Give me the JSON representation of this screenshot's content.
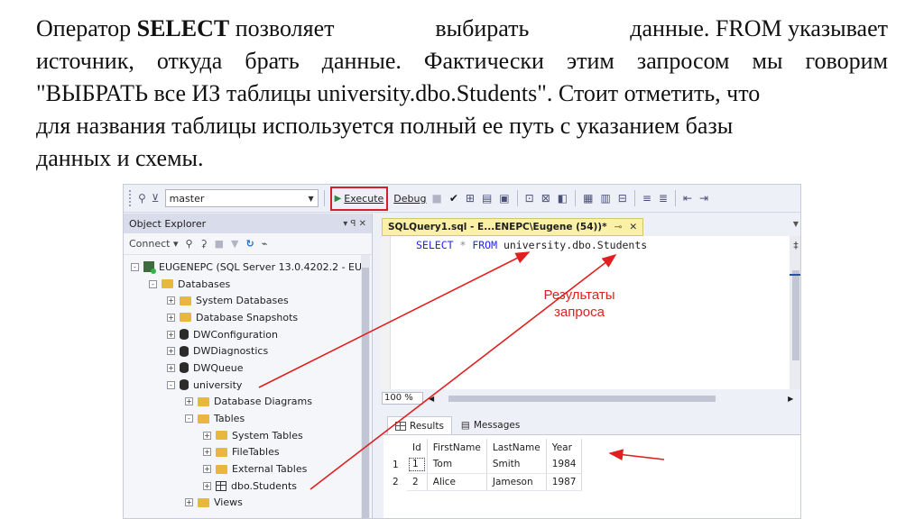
{
  "paragraph": {
    "line1_a": "Оператор",
    "line1_b": "SELECT",
    "line1_c": "позволяет",
    "line1_d": "выбирать",
    "line1_e": "данные. FROM указывает",
    "line2": "источник, откуда брать данные. Фактически этим запросом мы говорим",
    "line3": "\"ВЫБРАТЬ все ИЗ таблицы university.dbo.Students\". Стоит отметить, что",
    "line4": "для названия таблицы используется полный ее путь с указанием базы",
    "line5": "данных и схемы."
  },
  "toolbar": {
    "database": "master",
    "execute_label": "Execute",
    "debug_label": "Debug"
  },
  "object_explorer": {
    "title": "Object Explorer",
    "pin": "▾ ꟼ ✕",
    "connect_label": "Connect ▾",
    "tree": [
      {
        "label": "EUGENEPC (SQL Server 13.0.4202.2 - EU",
        "icon": "server-icon",
        "expander": "-"
      },
      {
        "label": "Databases",
        "icon": "folder-icon",
        "expander": "-"
      },
      {
        "label": "System Databases",
        "icon": "folder-icon",
        "expander": "+"
      },
      {
        "label": "Database Snapshots",
        "icon": "folder-icon",
        "expander": "+"
      },
      {
        "label": "DWConfiguration",
        "icon": "database-icon",
        "expander": "+"
      },
      {
        "label": "DWDiagnostics",
        "icon": "database-icon",
        "expander": "+"
      },
      {
        "label": "DWQueue",
        "icon": "database-icon",
        "expander": "+"
      },
      {
        "label": "university",
        "icon": "database-icon",
        "expander": "-"
      },
      {
        "label": "Database Diagrams",
        "icon": "folder-icon",
        "expander": "+"
      },
      {
        "label": "Tables",
        "icon": "folder-icon",
        "expander": "-"
      },
      {
        "label": "System Tables",
        "icon": "folder-icon",
        "expander": "+"
      },
      {
        "label": "FileTables",
        "icon": "folder-icon",
        "expander": "+"
      },
      {
        "label": "External Tables",
        "icon": "folder-icon",
        "expander": "+"
      },
      {
        "label": "dbo.Students",
        "icon": "table-icon",
        "expander": "+"
      },
      {
        "label": "Views",
        "icon": "folder-icon",
        "expander": "+"
      }
    ]
  },
  "query_tab": {
    "title": "SQLQuery1.sql - E...ENEPC\\Eugene (54))*",
    "pin": "⊸",
    "close": "✕"
  },
  "editor": {
    "kw_select": "SELECT",
    "star": " * ",
    "kw_from": "FROM",
    "table": " university.dbo.Students"
  },
  "zoom": "100 %",
  "results_tabs": {
    "results": "Results",
    "messages": "Messages"
  },
  "results": {
    "columns": [
      "Id",
      "FirstName",
      "LastName",
      "Year"
    ],
    "rows": [
      {
        "num": "1",
        "Id": "1",
        "FirstName": "Tom",
        "LastName": "Smith",
        "Year": "1984"
      },
      {
        "num": "2",
        "Id": "2",
        "FirstName": "Alice",
        "LastName": "Jameson",
        "Year": "1987"
      }
    ]
  },
  "annotation": {
    "line1": "Результаты",
    "line2": "запроса"
  },
  "colors": {
    "annotation_red": "#e02020",
    "keyword_blue": "#2323ff",
    "tab_yellow": "#fbf0a8"
  }
}
